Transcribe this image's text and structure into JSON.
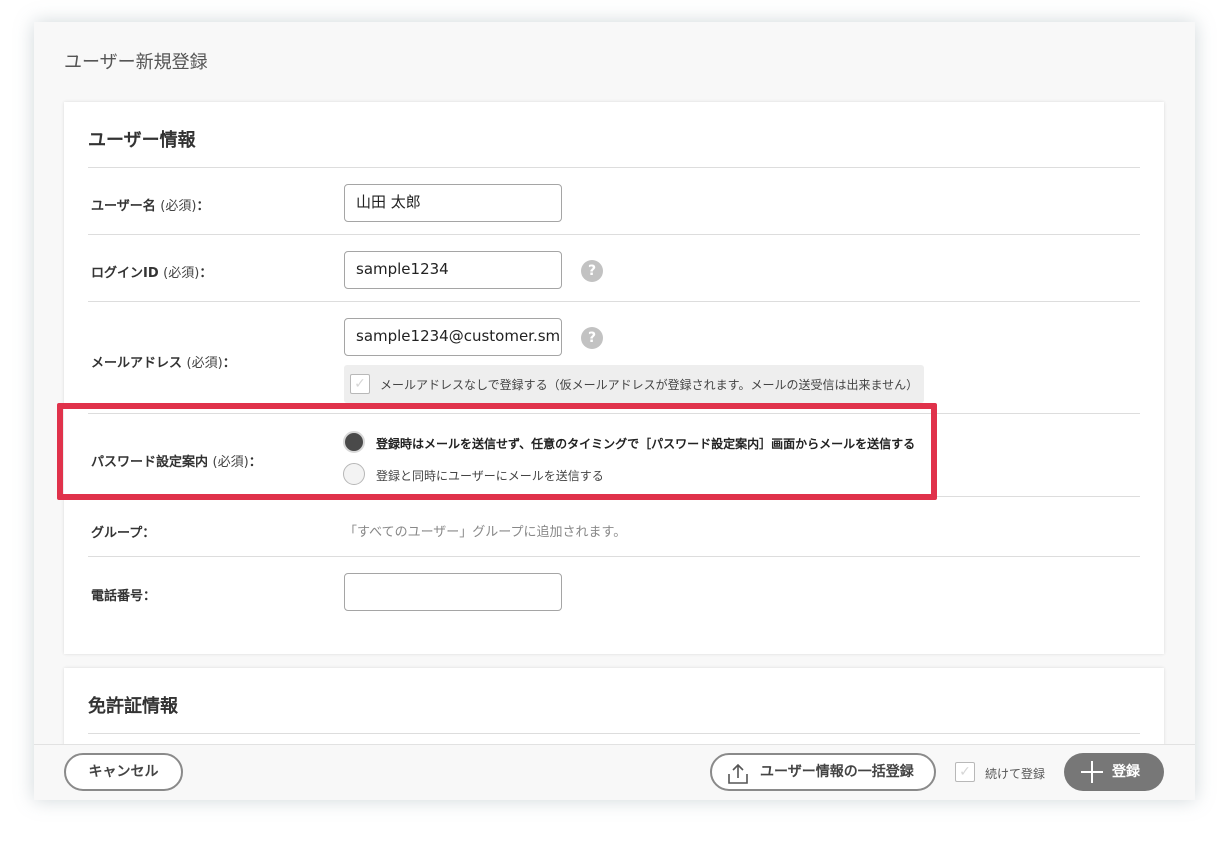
{
  "page": {
    "title": "ユーザー新規登録"
  },
  "user_info": {
    "heading": "ユーザー情報",
    "fields": {
      "username": {
        "label": "ユーザー名",
        "required": "(必須)",
        "colon": "：",
        "value": "山田 太郎"
      },
      "login_id": {
        "label": "ログインID",
        "required": "(必須)",
        "colon": "：",
        "value": "sample1234",
        "help": "?"
      },
      "email": {
        "label": "メールアドレス",
        "required": "(必須)",
        "colon": "：",
        "value": "sample1234@customer.sm",
        "help": "?",
        "no_email_option": "メールアドレスなしで登録する（仮メールアドレスが登録されます。メールの送受信は出来ません）",
        "no_email_checked": false
      },
      "password_guide": {
        "label": "パスワード設定案内",
        "required": "(必須)",
        "colon": "：",
        "options": [
          {
            "label": "登録時はメールを送信せず、任意のタイミングで［パスワード設定案内］画面からメールを送信する",
            "selected": true
          },
          {
            "label": "登録と同時にユーザーにメールを送信する",
            "selected": false
          }
        ]
      },
      "group": {
        "label": "グループ",
        "colon": "：",
        "note": "「すべてのユーザー」グループに追加されます。"
      },
      "phone": {
        "label": "電話番号",
        "colon": "：",
        "value": ""
      }
    }
  },
  "license_info": {
    "heading": "免許証情報"
  },
  "footer": {
    "cancel_label": "キャンセル",
    "bulk_label": "ユーザー情報の一括登録",
    "continue_label": "続けて登録",
    "continue_checked": false,
    "register_label": "登録"
  },
  "icons": {
    "help": "question-circle-icon",
    "upload": "upload-icon",
    "plus": "plus-icon",
    "check": "check-icon"
  },
  "colors": {
    "highlight": "#e0324b",
    "primary_button": "#777777",
    "help_icon": "#c2c2c2"
  }
}
